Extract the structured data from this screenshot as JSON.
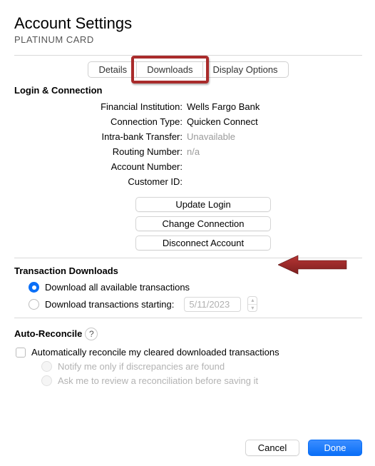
{
  "header": {
    "title": "Account Settings",
    "subtitle": "PLATINUM CARD"
  },
  "tabs": {
    "details": "Details",
    "downloads": "Downloads",
    "display": "Display Options"
  },
  "login": {
    "heading": "Login & Connection",
    "fi_label": "Financial Institution:",
    "fi_value": "Wells Fargo Bank",
    "ct_label": "Connection Type:",
    "ct_value": "Quicken Connect",
    "ibt_label": "Intra-bank Transfer:",
    "ibt_value": "Unavailable",
    "rn_label": "Routing Number:",
    "rn_value": "n/a",
    "an_label": "Account Number:",
    "an_value": "",
    "cid_label": "Customer ID:",
    "cid_value": ""
  },
  "buttons": {
    "update": "Update Login",
    "change": "Change Connection",
    "disconnect": "Disconnect Account"
  },
  "trans": {
    "heading": "Transaction Downloads",
    "opt_all": "Download all available transactions",
    "opt_starting": "Download transactions starting:",
    "date": "5/11/2023"
  },
  "auto": {
    "heading": "Auto-Reconcile",
    "main": "Automatically reconcile my cleared downloaded transactions",
    "sub1": "Notify me only if discrepancies are found",
    "sub2": "Ask me to review a reconciliation before saving it"
  },
  "footer": {
    "cancel": "Cancel",
    "done": "Done"
  }
}
